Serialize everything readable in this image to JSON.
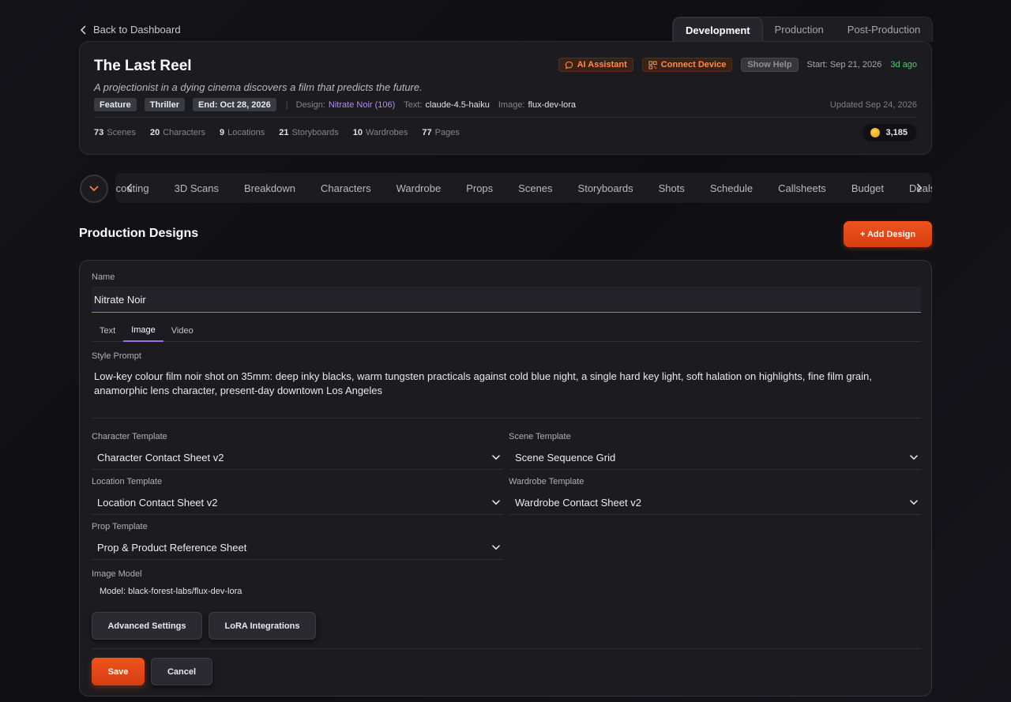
{
  "back_label": "Back to Dashboard",
  "phase_tabs": [
    "Development",
    "Production",
    "Post-Production"
  ],
  "project": {
    "title": "The Last Reel",
    "logline": "A projectionist in a dying cinema discovers a film that predicts the future.",
    "actions": {
      "ai_assistant": "AI Assistant",
      "connect_device": "Connect Device",
      "show_help": "Show Help"
    },
    "start": "Start: Sep 21, 2026",
    "ago": "3d ago",
    "tags": [
      "Feature",
      "Thriller",
      "End: Oct 28, 2026"
    ],
    "design_label": "Design:",
    "design_value": "Nitrate Noir (106)",
    "text_label": "Text:",
    "text_value": "claude-4.5-haiku",
    "image_label": "Image:",
    "image_value": "flux-dev-lora",
    "updated": "Updated Sep 24, 2026",
    "stats": [
      {
        "value": "73",
        "label": "Scenes"
      },
      {
        "value": "20",
        "label": "Characters"
      },
      {
        "value": "9",
        "label": "Locations"
      },
      {
        "value": "21",
        "label": "Storyboards"
      },
      {
        "value": "10",
        "label": "Wardrobes"
      },
      {
        "value": "77",
        "label": "Pages"
      }
    ],
    "credits": "3,185"
  },
  "nav_items": [
    "Scouting",
    "3D Scans",
    "Breakdown",
    "Characters",
    "Wardrobe",
    "Props",
    "Scenes",
    "Storyboards",
    "Shots",
    "Schedule",
    "Callsheets",
    "Budget",
    "Deals"
  ],
  "section": {
    "title": "Production Designs",
    "add_button": "+ Add Design"
  },
  "form": {
    "name_label": "Name",
    "name_value": "Nitrate Noir",
    "mode_tabs": [
      "Text",
      "Image",
      "Video"
    ],
    "active_mode": "Image",
    "style_prompt_label": "Style Prompt",
    "style_prompt": "Low-key colour film noir shot on 35mm: deep inky blacks, warm tungsten practicals against cold blue night, a single hard key light, soft halation on highlights, fine film grain, anamorphic lens character, present-day downtown Los Angeles",
    "character_template": {
      "label": "Character Template",
      "value": "Character Contact Sheet v2"
    },
    "scene_template": {
      "label": "Scene Template",
      "value": "Scene Sequence Grid"
    },
    "location_template": {
      "label": "Location Template",
      "value": "Location Contact Sheet v2"
    },
    "wardrobe_template": {
      "label": "Wardrobe Template",
      "value": "Wardrobe Contact Sheet v2"
    },
    "prop_template": {
      "label": "Prop Template",
      "value": "Prop & Product Reference Sheet"
    },
    "image_model_label": "Image Model",
    "image_model_value": "Model: black-forest-labs/flux-dev-lora",
    "advanced_button": "Advanced Settings",
    "lora_button": "LoRA Integrations",
    "save_button": "Save",
    "cancel_button": "Cancel"
  },
  "colors": {
    "accent": "#e94a17",
    "link": "#b58af0",
    "success": "#4fd16b",
    "tab_underline": "#9b6ce6"
  }
}
